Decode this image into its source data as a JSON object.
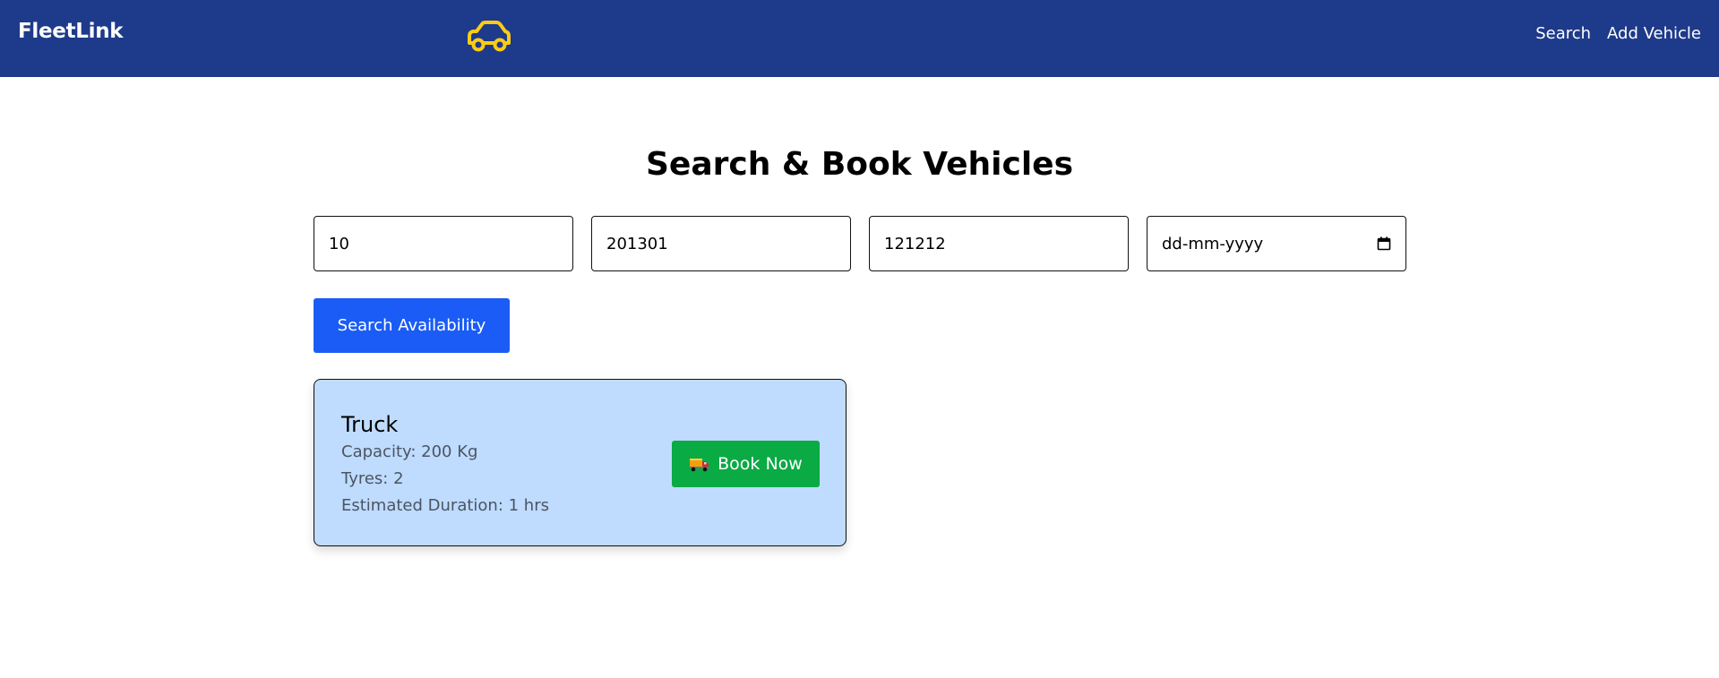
{
  "app": {
    "brand": "FleetLink"
  },
  "nav": {
    "links": [
      {
        "label": "Search"
      },
      {
        "label": "Add Vehicle"
      }
    ]
  },
  "page": {
    "title": "Search & Book Vehicles"
  },
  "search": {
    "capacity_value": "10",
    "from_pincode_value": "201301",
    "to_pincode_value": "121212",
    "date_placeholder": "dd-mm-yyyy",
    "button_label": "Search Availability"
  },
  "results": [
    {
      "name": "Truck",
      "capacity": "Capacity: 200 Kg",
      "tyres": "Tyres: 2",
      "duration": "Estimated Duration: 1 hrs",
      "book_label": "Book Now"
    }
  ],
  "colors": {
    "navbar": "#1e3a8a",
    "logo_icon": "#facc15",
    "primary_button": "#1a5cf5",
    "book_button": "#0aaa44",
    "card_background": "#bfdbfe"
  },
  "icons": {
    "logo": "car-icon",
    "date": "calendar-icon",
    "book": "truck-icon"
  }
}
